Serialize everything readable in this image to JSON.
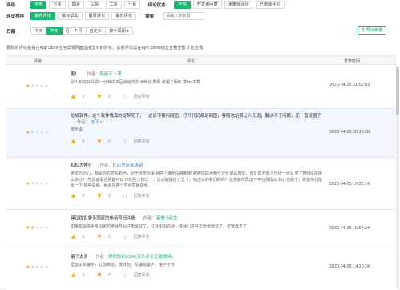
{
  "filters": {
    "rating": {
      "label": "评级",
      "options": [
        "全部",
        "五星",
        "四星",
        "三星",
        "二星",
        "一星"
      ],
      "active": 0
    },
    "review_status": {
      "label": "评论状态",
      "options": [
        "全部",
        "开发者回复",
        "未删除评论",
        "已删除评论"
      ],
      "active": 0
    },
    "sort": {
      "label": "评论排序",
      "options": [
        "最新评论",
        "最有帮助",
        "最赞评论",
        "最低评论"
      ],
      "active": 0
    },
    "search": {
      "label": "搜索",
      "placeholder": "请输入搜索词"
    },
    "date": {
      "label": "日期",
      "options": [
        "今天",
        "昨天",
        "近一个月",
        "自定义",
        "按半周期 ▾"
      ],
      "active": 1
    },
    "export_label": "导出数据"
  },
  "hint": "要跳的评论是指在App Store应用详情页面直接显示的评论，其他评论需在App Store点击'查看全部'才能查看。",
  "table": {
    "headers": {
      "rating": "评级",
      "comment": "评论",
      "time": "发表时间"
    },
    "rows": [
      {
        "stars": 1,
        "title": "差！",
        "author_label": "作者：",
        "author": "阿郝不上课",
        "body": "别人和好好吗'你一分钟内不回就给你扣大伸分 秀啊 就超了网吵 算hm不秀",
        "likes": "0",
        "dislikes": "0",
        "reply": "回复评论",
        "time": "2020-04-25 21:52:03"
      },
      {
        "stars": 1,
        "title": "垃圾软件。这个软件我真的是醉死了，一边说不要用网图，打开代码都是网图，客服也是很让人无语，解决不了问题，还一直说圈子",
        "author_label": "作者：",
        "author": "包仔 »",
        "body": "很无语",
        "likes": "0",
        "dislikes": "0",
        "reply": "回复评论",
        "time": "2020-04-25 20:15:28",
        "highlight": true
      },
      {
        "stars": 1,
        "title": "扣扣大伸分",
        "author_label": "作者：",
        "author": "比心老玩家讲讲",
        "body": "亲爱的比心，我是你的忠实粉丝，对于今天的事 我在上面听没接到单 被被扣扣大伸分 8分 很是难受。你们再不能人也化一点么 要了8秒吗  扣那么多分？ 然后客服还那都可以 你们在少扣之一，比心提提自分之十。她边么到我们的吗？还想做你再这个平台游戏么 我心也刷了。希望你们能化一下 有些说我。我会在各个平台直播说明。",
        "likes": "0",
        "dislikes": "0",
        "reply": "回复评论",
        "time": "2020-04-25 19:32:14"
      },
      {
        "stars": 2,
        "title": "建议提供更多国家的电话号码注册",
        "author_label": "作者：",
        "author": "蒋墨小玩女",
        "body": "如果能提供更多国家的电话号码注册就好了，只有中国的话，像我们这些华侨很就玩了。还望改不了",
        "likes": "0",
        "dislikes": "0",
        "reply": "回复评论",
        "time": "2020-04-25 16:54:34"
      },
      {
        "stars": 1,
        "title": "骗子太多",
        "author_label": "作者：",
        "author": "静和知初6364",
        "tag": "(该条评论已被删除)",
        "body": "里面太多骗子，让加微信，发红包，反骗给客户，客户不管",
        "likes": "0",
        "dislikes": "0",
        "reply": "回复评论",
        "time": "2020-04-25 14:10:24"
      }
    ]
  }
}
